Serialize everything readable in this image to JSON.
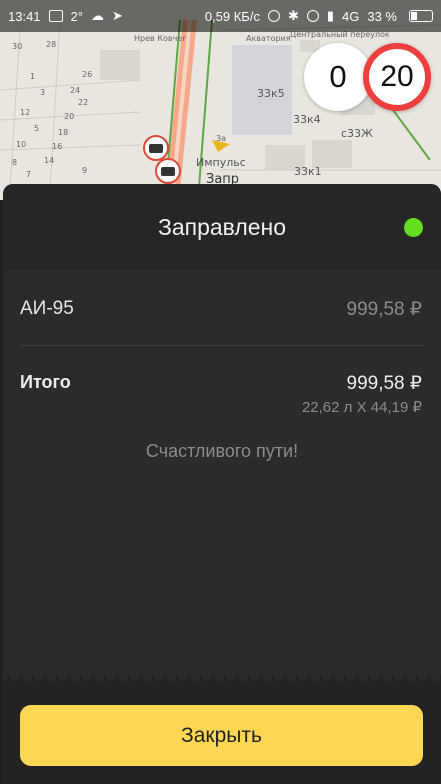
{
  "status_bar": {
    "time": "13:41",
    "temperature": "2°",
    "network_speed": "0,59 КБ/с",
    "network_type": "4G",
    "battery_percent": "33 %",
    "battery_level": 0.33
  },
  "map": {
    "labels": {
      "place_name": "Импульс",
      "building_1": "33к5",
      "building_2": "33к4",
      "building_3": "с33Ж",
      "building_4": "33к1",
      "street_number": "3а",
      "partial": "Запр",
      "top_label": "Акватория",
      "top_label_2": "Центральный переулок",
      "top_label_3": "Нрев Ковчег"
    },
    "numbers": [
      "30",
      "28",
      "26",
      "24",
      "22",
      "20",
      "18",
      "16",
      "14",
      "10",
      "8",
      "12",
      "1",
      "3",
      "5",
      "7",
      "9"
    ]
  },
  "speed": {
    "current": "0",
    "limit": "20"
  },
  "sheet": {
    "title": "Заправлено",
    "status_color": "#66dd22",
    "fuel_name": "АИ-95",
    "fuel_price": "999,58 ₽",
    "total_label": "Итого",
    "total_amount": "999,58 ₽",
    "total_detail": "22,62 л X 44,19 ₽",
    "wish": "Счастливого пути!",
    "close_label": "Закрыть"
  },
  "colors": {
    "accent": "#fdd754",
    "limit_ring": "#ee3f3f",
    "sheet_bg": "#2b2b2b"
  }
}
